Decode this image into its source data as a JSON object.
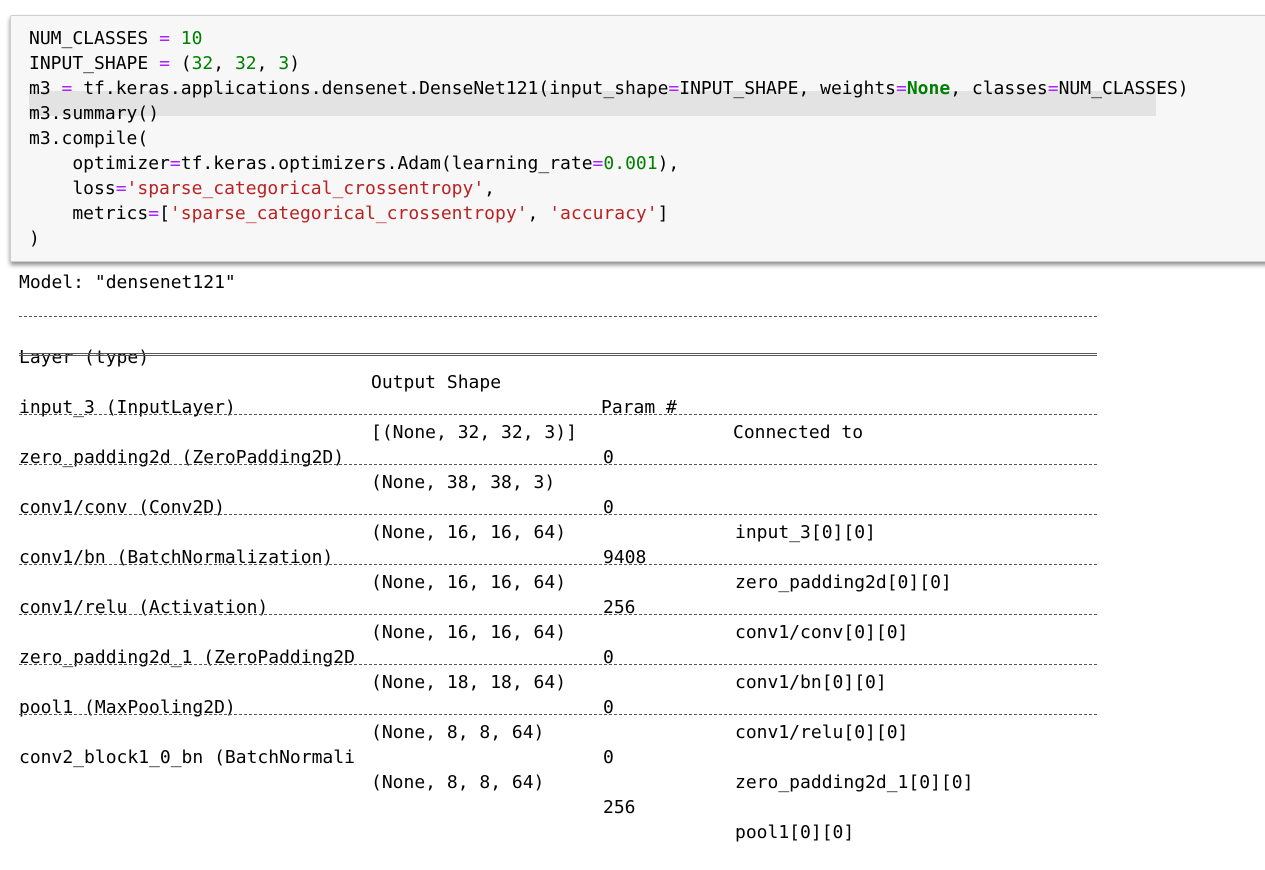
{
  "code": {
    "num_classes_name": "NUM_CLASSES",
    "num_classes_value": "10",
    "input_shape_name": "INPUT_SHAPE",
    "input_shape_open": "(",
    "input_shape_a": "32",
    "input_shape_b": "32",
    "input_shape_c": "3",
    "input_shape_close": ")",
    "line3_pre": "m3",
    "line3_mid": " tf.keras.applications.densenet.DenseNet121(input_shape",
    "line3_arg1": "INPUT_SHAPE, weights",
    "line3_none": "None",
    "line3_arg2": ", classes",
    "line3_tail": "NUM_CLASSES)",
    "line4": "m3.summary()",
    "line5": "m3.compile(",
    "line6_pre": "    optimizer",
    "line6_mid": "tf.keras.optimizers.Adam(learning_rate",
    "line6_num": "0.001",
    "line6_end": "),",
    "line7_pre": "    loss",
    "line7_str": "'sparse_categorical_crossentropy'",
    "line7_end": ",",
    "line8_pre": "    metrics",
    "line8_open": "[",
    "line8_str1": "'sparse_categorical_crossentropy'",
    "line8_sep": ", ",
    "line8_str2": "'accuracy'",
    "line8_close": "]",
    "line9": ")"
  },
  "output": {
    "model_line": "Model: \"densenet121\"",
    "headers": [
      "Layer (type)",
      "Output Shape",
      "Param #",
      "Connected to"
    ],
    "rows": [
      [
        "input_3 (InputLayer)",
        "[(None, 32, 32, 3)]",
        "0",
        ""
      ],
      [
        "zero_padding2d (ZeroPadding2D)",
        "(None, 38, 38, 3)",
        "0",
        "input_3[0][0]"
      ],
      [
        "conv1/conv (Conv2D)",
        "(None, 16, 16, 64)",
        "9408",
        "zero_padding2d[0][0]"
      ],
      [
        "conv1/bn (BatchNormalization)",
        "(None, 16, 16, 64)",
        "256",
        "conv1/conv[0][0]"
      ],
      [
        "conv1/relu (Activation)",
        "(None, 16, 16, 64)",
        "0",
        "conv1/bn[0][0]"
      ],
      [
        "zero_padding2d_1 (ZeroPadding2D",
        "(None, 18, 18, 64)",
        "0",
        "conv1/relu[0][0]"
      ],
      [
        "pool1 (MaxPooling2D)",
        "(None, 8, 8, 64)",
        "0",
        "zero_padding2d_1[0][0]"
      ],
      [
        "conv2_block1_0_bn (BatchNormali",
        "(None, 8, 8, 64)",
        "256",
        "pool1[0][0]"
      ]
    ]
  }
}
